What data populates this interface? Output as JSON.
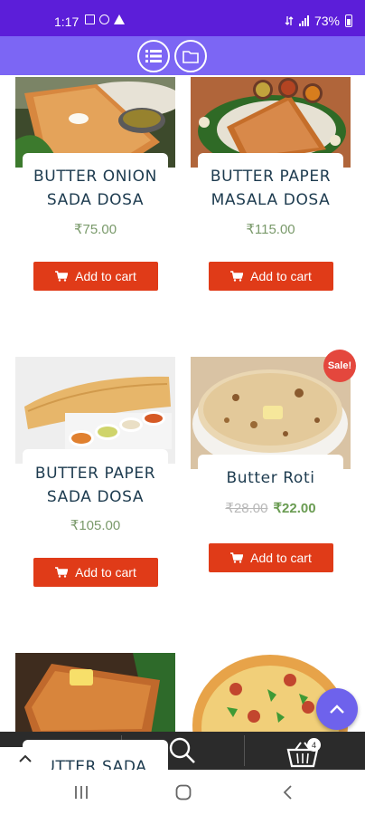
{
  "status_bar": {
    "time": "1:17",
    "battery": "73%"
  },
  "products": [
    {
      "title_line1": "BUTTER ONION",
      "title_line2": "SADA DOSA",
      "price": "₹75.00",
      "cart_label": "Add to cart"
    },
    {
      "title_line1": "BUTTER PAPER",
      "title_line2": "MASALA DOSA",
      "price": "₹115.00",
      "cart_label": "Add to cart"
    },
    {
      "title_line1": "BUTTER PAPER",
      "title_line2": "SADA DOSA",
      "price": "₹105.00",
      "cart_label": "Add to cart"
    },
    {
      "title_line1": "Butter Roti",
      "sale_badge": "Sale!",
      "old_price": "₹28.00",
      "price": "₹22.00",
      "cart_label": "Add to cart"
    },
    {
      "title_line1": "UTTER SADA"
    }
  ],
  "bottom_nav": {
    "cart_count": "4"
  },
  "colors": {
    "status_bar": "#5c1ed9",
    "toolbar": "#7c66f4",
    "title_text": "#1d3b4f",
    "price_text": "#7a9a6b",
    "add_to_cart": "#e03b18",
    "sale_badge": "#e4473d",
    "fab": "#6e62ec",
    "bottom_nav": "#2b2b2b"
  }
}
